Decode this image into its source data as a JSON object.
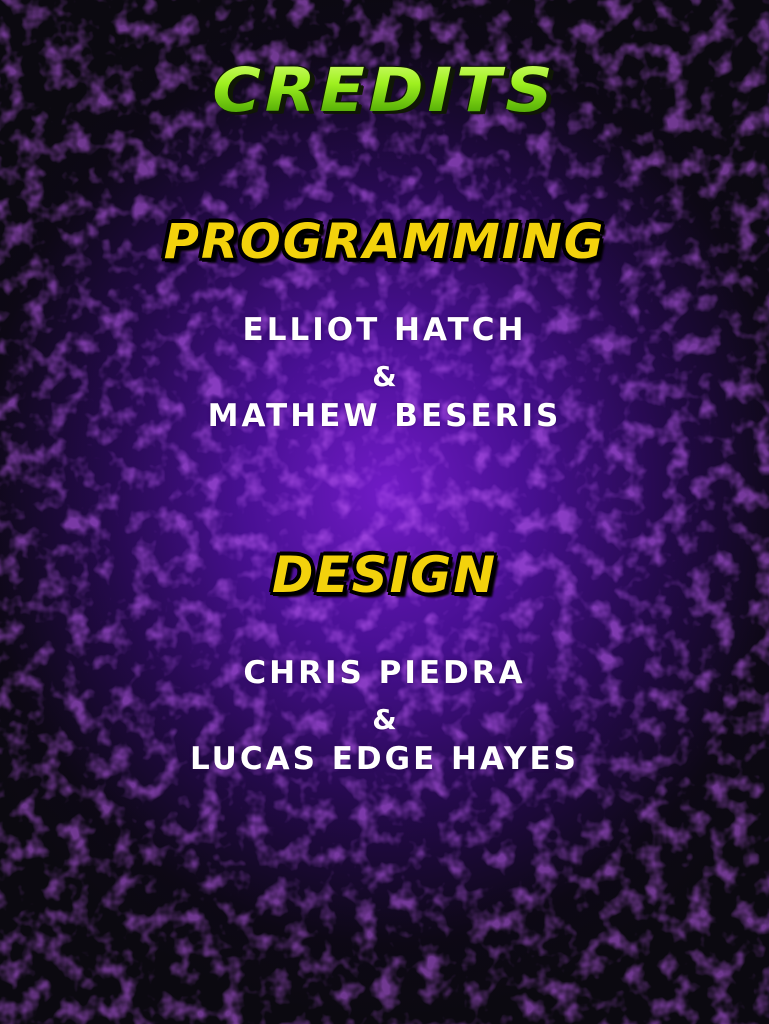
{
  "screen": {
    "title": "CREDITS"
  },
  "sections": [
    {
      "heading": "PROGRAMMING",
      "lines": [
        "ELLIOT HATCH",
        "&",
        "MATHEW BESERIS"
      ]
    },
    {
      "heading": "DESIGN",
      "lines": [
        "CHRIS PIEDRA",
        "&",
        "LUCAS EDGE HAYES"
      ]
    }
  ],
  "colors": {
    "title_green": "#8fe01e",
    "heading_yellow": "#f3d20c",
    "name_white": "#ffffff",
    "background_purple": "#5c12be"
  }
}
